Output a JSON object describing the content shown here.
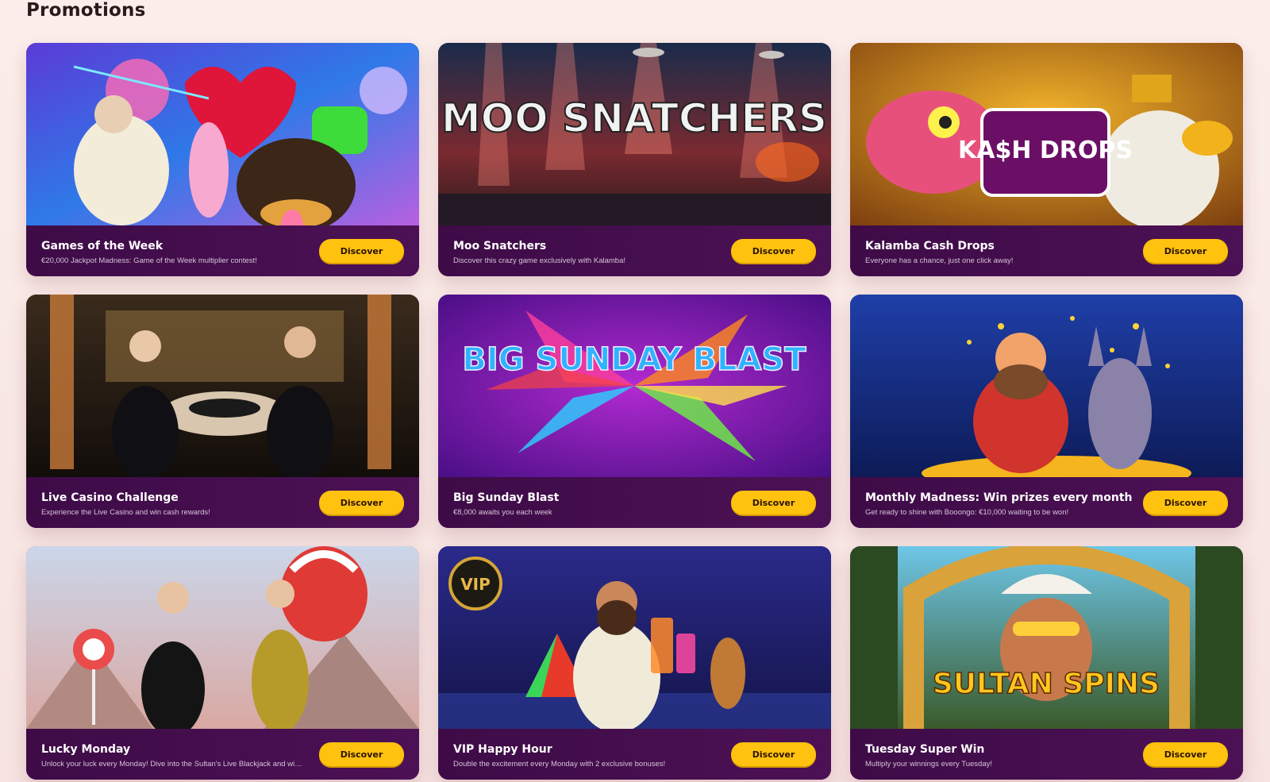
{
  "page": {
    "title": "Promotions"
  },
  "promotions": [
    {
      "title": "Games of the Week",
      "description": "€20,000 Jackpot Madness: Game of the Week multiplier contest!",
      "button": "Discover",
      "banner_text": ""
    },
    {
      "title": "Moo Snatchers",
      "description": "Discover this crazy game exclusively with Kalamba!",
      "button": "Discover",
      "banner_text": "MOO SNATCHERS"
    },
    {
      "title": "Kalamba Cash Drops",
      "description": "Everyone has a chance, just one click away!",
      "button": "Discover",
      "banner_text": "KA$H DROPS"
    },
    {
      "title": "Live Casino Challenge",
      "description": "Experience the Live Casino and win cash rewards!",
      "button": "Discover",
      "banner_text": ""
    },
    {
      "title": "Big Sunday Blast",
      "description": "€8,000 awaits you each week",
      "button": "Discover",
      "banner_text": "BIG SUNDAY BLAST"
    },
    {
      "title": "Monthly Madness: Win prizes every month",
      "description": "Get ready to shine with Booongo: €10,000 waiting to be won!",
      "button": "Discover",
      "banner_text": ""
    },
    {
      "title": "Lucky Monday",
      "description": "Unlock your luck every Monday! Dive into the Sultan's Live Blackjack and win b...",
      "button": "Discover",
      "banner_text": ""
    },
    {
      "title": "VIP Happy Hour",
      "description": "Double the excitement every Monday with 2 exclusive bonuses!",
      "button": "Discover",
      "banner_text": "VIP"
    },
    {
      "title": "Tuesday Super Win",
      "description": "Multiply your winnings every Tuesday!",
      "button": "Discover",
      "banner_text": "SULTAN SPINS"
    }
  ],
  "colors": {
    "card_footer": "#4a0f50",
    "button": "#ffc20e",
    "background": "#fbeeea"
  }
}
